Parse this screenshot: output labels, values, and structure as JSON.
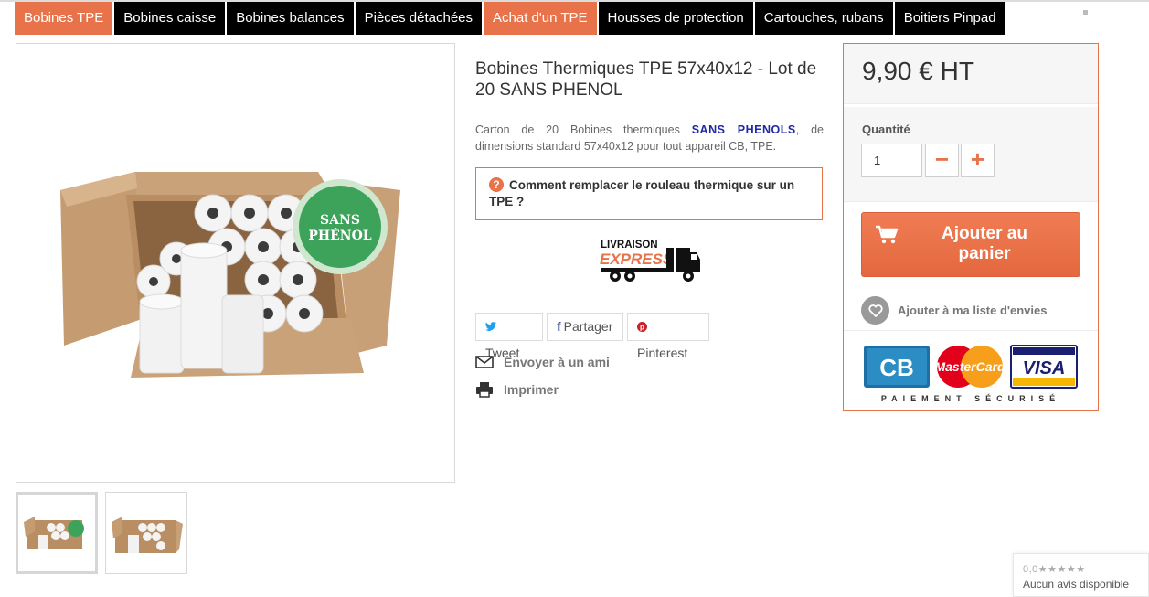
{
  "nav": {
    "items": [
      {
        "label": "Bobines TPE",
        "active": true
      },
      {
        "label": "Bobines caisse",
        "active": false
      },
      {
        "label": "Bobines balances",
        "active": false
      },
      {
        "label": "Pièces détachées",
        "active": false
      },
      {
        "label": "Achat d'un TPE",
        "active": true
      },
      {
        "label": "Housses de protection",
        "active": false
      },
      {
        "label": "Cartouches, rubans",
        "active": false
      },
      {
        "label": "Boitiers Pinpad",
        "active": false
      }
    ]
  },
  "product": {
    "title": "Bobines Thermiques TPE 57x40x12 - Lot de 20 SANS PHENOL",
    "description_prefix": "Carton de 20 Bobines thermiques ",
    "description_strong": "SANS PHENOLS",
    "description_suffix": ", de dimensions standard 57x40x12 pour tout appareil CB, TPE.",
    "image_badge_line1": "SANS",
    "image_badge_line2": "PHÉNOL",
    "help_text": "Comment remplacer le rouleau thermique sur un TPE ?",
    "help_icon": "?"
  },
  "livraison": {
    "line1": "LIVRAISON",
    "line2": "EXPRESS"
  },
  "share": {
    "tweet": "Tweet",
    "partager": "Partager",
    "pinterest": "Pinterest"
  },
  "actions": {
    "send_friend": "Envoyer à un ami",
    "print": "Imprimer"
  },
  "buy": {
    "price": "9,90 € HT",
    "quantity_label": "Quantité",
    "quantity_value": "1",
    "minus": "−",
    "plus": "+",
    "add_to_cart": "Ajouter au panier",
    "wishlist": "Ajouter à ma liste d'envies",
    "secure_payment": "PAIEMENT SÉCURISÉ",
    "cards": {
      "cb": "CB",
      "mastercard": "MasterCard",
      "visa": "VISA"
    }
  },
  "reviews": {
    "rating": "0,0★★★★★",
    "none": "Aucun avis disponible"
  },
  "colors": {
    "accent": "#e8724a",
    "nav_bg": "#000000",
    "strong_text": "#1f2aa5"
  }
}
